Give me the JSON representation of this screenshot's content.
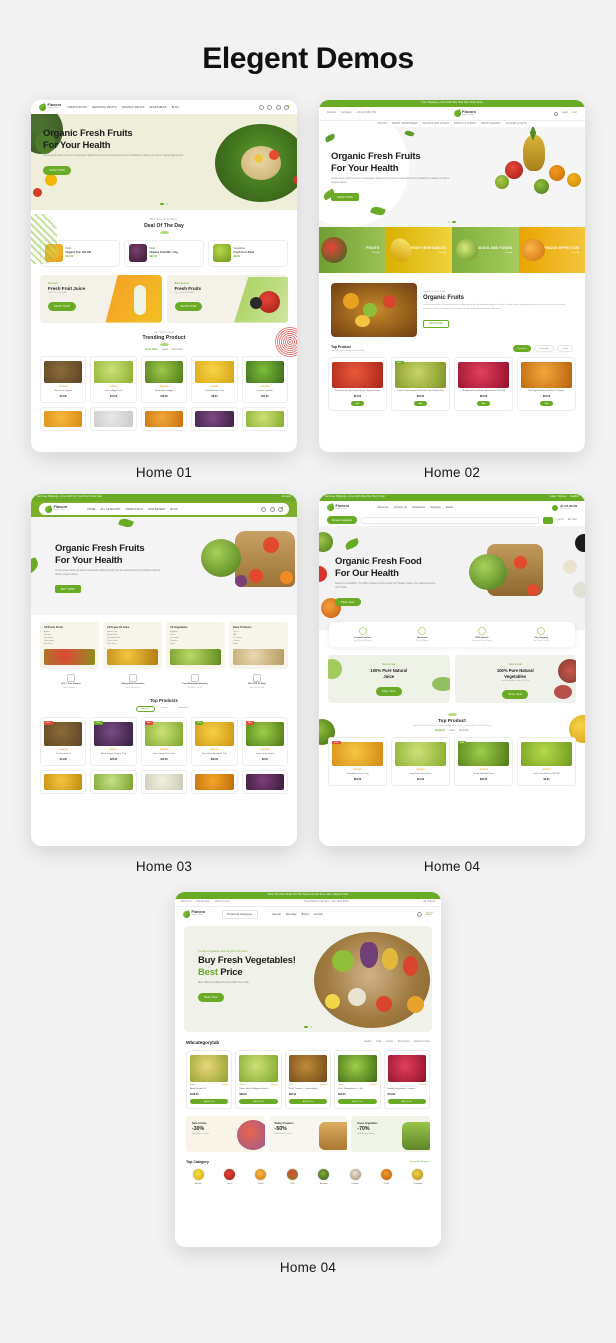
{
  "page": {
    "title": "Elegent Demos",
    "background": "#f2f2f2",
    "accent": "#6aab26"
  },
  "demos": [
    {
      "label": "Home 01",
      "brand": "Flavoro",
      "brand_tagline": "Organic Store",
      "announcement": "",
      "nav": [
        "FRESH FRUITS",
        "SEASONAL FRUITS",
        "ORGANIC FRUITS",
        "VEGETABLES",
        "BLOG"
      ],
      "hero": {
        "heading_line1": "Organic Fresh Fruits",
        "heading_line2": "For Your Health",
        "paragraph": "Lorem ipsum dolor sit amet consectetur adipiscing elit sed do eiusmod tempor incididunt ut labore et dolore magna aliqua enim.",
        "button": "SHOP NOW"
      },
      "deal": {
        "sub": "Best Special Products",
        "heading": "Deal Of The Day"
      },
      "deal_items": [
        {
          "tag": "30%",
          "cat": "Fruits",
          "name": "Organic Tea, 100 GM",
          "price": "$12.00",
          "old": "$18.00"
        },
        {
          "tag": "20%",
          "cat": "Fruits",
          "name": "Organic Fruit Mix, 1 Kg",
          "price": "$22.00",
          "old": "$30.00"
        },
        {
          "tag": "15%",
          "cat": "Vegetables",
          "name": "Fresh Corn Pack",
          "price": "$9.00",
          "old": "$14.00"
        }
      ],
      "promos": [
        {
          "sub": "Summer",
          "heading": "Fresh Fruit Juice",
          "paragraph": "Up to 30% Off Today",
          "button": "SHOP NOW"
        },
        {
          "sub": "Best Season",
          "heading": "Fresh Fruits",
          "paragraph": "Up to 40% Off Today",
          "button": "SHOP NOW"
        }
      ],
      "trending": {
        "sub": "Our Top Product",
        "heading": "Trending Product"
      },
      "trending_tabs": [
        "Fresh Juice",
        "Latest",
        "Best Seller"
      ],
      "products": [
        {
          "name": "Kiwi Fresh Organic",
          "price": "$14.00",
          "old": "$20.00",
          "stars": "★★★★★",
          "tag": "NEW"
        },
        {
          "name": "Green Apple Pack",
          "price": "$11.00",
          "old": "$16.00",
          "stars": "★★★★☆",
          "tag": ""
        },
        {
          "name": "Fresh Green Veggie",
          "price": "$18.00",
          "old": "$24.00",
          "stars": "★★★★★",
          "tag": "SALE"
        },
        {
          "name": "Yellow Banana 1 Kg",
          "price": "$8.00",
          "old": "$12.00",
          "stars": "★★★★☆",
          "tag": ""
        },
        {
          "name": "Organic Leaf Mix",
          "price": "$21.00",
          "old": "$28.00",
          "stars": "★★★★★",
          "tag": ""
        }
      ]
    },
    {
      "label": "Home 02",
      "brand": "Flavoro",
      "brand_tagline": "Organic Store",
      "announcement": "Free Shipping + Free Gifts Buy Now Next Order Now",
      "topbar_left": [
        "Contact",
        "Compare",
        "+91 123 456 789"
      ],
      "topbar_right": [
        "Search",
        "Login",
        "Cart"
      ],
      "nav": [
        "FRUITS",
        "FRESH VEGETABLES",
        "SNACKS AND FOODS",
        "DRINKS & JUICES",
        "FRESH BAKERY",
        "ALMOND & NUTS"
      ],
      "hero": {
        "heading_line1": "Organic Fresh Fruits",
        "heading_line2": "For Your Health",
        "paragraph": "Lorem ipsum dolor sit amet consectetur adipiscing elit sed do eiusmod tempor incididunt ut labore et dolore magna aliqua.",
        "button": "SHOP NOW"
      },
      "categories": [
        {
          "name": "FRUITS",
          "sub": "Shop All",
          "color": "#8bbc45"
        },
        {
          "name": "FRESH VEGETABLES",
          "sub": "Shop All",
          "color": "#e2b400"
        },
        {
          "name": "SNACKS AND FOODS",
          "sub": "Shop All",
          "color": "#8bbc45"
        },
        {
          "name": "ENORMOUS EFFECTUM",
          "sub": "Shop All",
          "color": "#e9a800"
        }
      ],
      "about": {
        "sub": "Organic / Fresh / Fruits",
        "heading": "Organic Fruits",
        "paragraph": "Lorem ipsum dolor sit amet consectetur adipiscing elit sed do eiusmod tempor incididunt ut labore dolore magna aliqua enim ad minim veniam quis nostrud exercitation ullamco laboris nisi ut aliquip ex ea commodo consequat duis aute irure.",
        "button": "READ MORE"
      },
      "top_product": {
        "heading": "Top Product",
        "sub": "Our Top Product Of Amazing Low Buy"
      },
      "top_tabs": [
        "Featured",
        "Bestseller",
        "Latest"
      ],
      "products": [
        {
          "name": "Fresh Hot Quality Tomato Sauce, 1kg Bulk Pack",
          "price": "$14.00",
          "old": "$20.00",
          "stars": "★★★★☆",
          "tag": ""
        },
        {
          "name": "Organic Dry Grapes, Perfect For Your Healthy Diet",
          "price": "$32.00",
          "old": "$40.00",
          "stars": "★★★★★",
          "tag": "SALE"
        },
        {
          "name": "Raspberry Fresh Nature Berry Basket 250 GM",
          "price": "$18.00",
          "old": "$26.00",
          "stars": "★★★★☆",
          "tag": ""
        },
        {
          "name": "Mix Vegetable Assorted Set Of Organic",
          "price": "$25.00",
          "old": "$30.00",
          "stars": "★★★★★",
          "tag": ""
        }
      ]
    },
    {
      "label": "Home 03",
      "brand": "Flavoro",
      "brand_tagline": "Organic Store",
      "announcement": "Get Free Shipping + Free Gifts On Your Next Order Now",
      "nav": [
        "HOME",
        "ALL CATEGORY",
        "FRESH FRUIT",
        "OUR BAKERY",
        "BLOG"
      ],
      "hero": {
        "heading_line1": "Organic Fresh Fruits",
        "heading_line2": "For Your Health",
        "paragraph": "Lorem ipsum dolor sit amet consectetur adipiscing elit sed do eiusmod tempor incididunt labore dolore magna aliqua.",
        "button": "BUY NOW"
      },
      "category_cards": [
        {
          "title": "All Fresh Fruits",
          "items": [
            "Apples",
            "Oranges",
            "Strawberry",
            "Watermelon",
            "Kiwi Fruits"
          ]
        },
        {
          "title": "All Types Of Juice",
          "items": [
            "Lemon Juice",
            "Mango Juice",
            "Vegetable Juice",
            "Cherry Juice",
            "Plum Juice"
          ]
        },
        {
          "title": "All Vegetables",
          "items": [
            "Eggplant",
            "Carrot",
            "Cucumber",
            "Pumpkin",
            "Onion"
          ]
        },
        {
          "title": "Dairy Products",
          "items": [
            "Yogurt",
            "Milk",
            "Ice Cream",
            "Cheese",
            "Butter"
          ]
        }
      ],
      "services": [
        {
          "title": "24 X 7 Free Support",
          "sub": "Online Support 24 / 7"
        },
        {
          "title": "Money Back Guarantee",
          "sub": "100% Money Back"
        },
        {
          "title": "Free Worldwide Shipping",
          "sub": "On Order Over $99"
        },
        {
          "title": "Win $100 To Shop",
          "sub": "Buy Now Win Gift"
        }
      ],
      "top_products": {
        "heading": "Top Products"
      },
      "top_tabs": [
        "Featured",
        "Latest",
        "Bestseller"
      ],
      "products": [
        {
          "name": "Kiwi Fresh Fruit",
          "price": "$14.00",
          "old": "$20.00",
          "stars": "★★★★★",
          "tag": "SALE"
        },
        {
          "name": "Black Grapes Organic 1 Kg",
          "price": "$26.00",
          "old": "$35.00",
          "stars": "★★★★☆",
          "tag": "NEW"
        },
        {
          "name": "Fresh Green Pear Pack",
          "price": "$12.00",
          "old": "$18.00",
          "stars": "★★★★★",
          "tag": "SALE"
        },
        {
          "name": "Pure Yellow Mangoes 2 Kg",
          "price": "$30.00",
          "old": "$42.00",
          "stars": "★★★★☆",
          "tag": "NEW"
        },
        {
          "name": "Long Green Gourd",
          "price": "$9.00",
          "old": "$14.00",
          "stars": "★★★★★",
          "tag": "SALE"
        }
      ]
    },
    {
      "label": "Home 04",
      "brand": "Flavoro",
      "brand_tagline": "Organic Store",
      "announcement": "Get Free Shipping + Free Gifts Now Buy Next Order",
      "topbar_right": [
        "Login / Signup",
        "English"
      ],
      "nav": [
        "About Us",
        "Contact Us",
        "Collections",
        "Shipping",
        "Deals"
      ],
      "phone": {
        "number": "+91 123 456 789",
        "label": "24/7 Support"
      },
      "search_placeholder": "Search Product...",
      "browse_button": "Browse Categories",
      "account": [
        "Log In",
        "My Cart"
      ],
      "hero": {
        "heading_line1": "Organic Fresh Food",
        "heading_line2": "For Our Health",
        "paragraph": "Reach For Healthier You With Organic Fresh Foods Our Health Foods Your Natural Choice Your Taste.",
        "button": "Shop Now"
      },
      "features": [
        {
          "title": "Curated Products",
          "sub": "Find The Best Product"
        },
        {
          "title": "Handmade",
          "sub": "Order Of Nature"
        },
        {
          "title": "100% Natural",
          "sub": "Get Fresh Natural Foods"
        },
        {
          "title": "Free Shipping",
          "sub": "Free Order Over $99"
        }
      ],
      "promos": [
        {
          "sub": "New arrival",
          "heading_line1": "100% Pure Natural",
          "heading_line2": "Juice",
          "paragraph": "",
          "button": "Shop Now"
        },
        {
          "sub": "New arrival",
          "heading_line1": "100% Pure Natural",
          "heading_line2": "Vegetables",
          "paragraph": "Fresh Vegetable Sale 30% Off",
          "button": "Shop Now"
        }
      ],
      "top_product": {
        "heading": "Top Product",
        "sub": "Organic Food In Fresh Products Mix With Your Compo With The Nutrients"
      },
      "top_tabs": [
        "Featured",
        "Latest",
        "Bestseller"
      ],
      "products": [
        {
          "name": "Fresh Apricot Fruit 1 Kg",
          "price": "$18.00",
          "old": "$25.00",
          "stars": "★★★★★",
          "tag": "SALE"
        },
        {
          "name": "Long Green Gourd Pack",
          "price": "$11.00",
          "old": "$16.00",
          "stars": "★★★★☆",
          "tag": ""
        },
        {
          "name": "Mixed Vegetable Tray",
          "price": "$26.00",
          "old": "$34.00",
          "stars": "★★★★★",
          "tag": "NEW"
        },
        {
          "name": "Fresh Green Beans 500 GM",
          "price": "$9.00",
          "old": "$13.00",
          "stars": "★★★★☆",
          "tag": ""
        }
      ]
    },
    {
      "label": "Home 04",
      "brand": "Flavoro",
      "brand_tagline": "Organic Store",
      "announcement": "Shop The Most Deals Off The Week And Get Free Gifts / Explore Now",
      "topbar_left": [
        "About Us",
        "My Account",
        "Wish List (0)"
      ],
      "topbar_center": "Need Help? Call Now : +91 1234 5678",
      "topbar_right": "All Orders",
      "browse_button": "Browse All Categories",
      "nav": [
        "Special",
        "Site Map",
        "Brand",
        "Contact"
      ],
      "cart": {
        "label": "My Cart",
        "total": "$0.00"
      },
      "hero": {
        "sub": "The Best Vegetables Store By All In One Store",
        "heading_line1": "Buy Fresh Vegetables!",
        "heading_accent": "Best",
        "heading_rest": " Price",
        "paragraph": "Best Offers And Big Discounts With Free Gifts",
        "button": "Shop Now"
      },
      "category_tab": {
        "heading": "Wbcategorytab"
      },
      "category_tabs": [
        "Exotic",
        "Kiwi",
        "Fruits",
        "Dry Fruits",
        "Exotics Fruits"
      ],
      "products": [
        {
          "tag": "Exotic",
          "name": "Apple Flavour 94°",
          "price": "$118.00",
          "old": "$135.00",
          "stars": "★★★★★",
          "count": "(3)",
          "button": "Add To Cart"
        },
        {
          "tag": "Classic",
          "name": "Rustic Early Fall Apples Bosco...",
          "price": "$98.00",
          "old": "$115.00",
          "stars": "★★★★★",
          "count": "(8)",
          "button": "Add To Cart"
        },
        {
          "tag": "ECO",
          "name": "Fresh Turmeric - Organically A...",
          "price": "$26.00",
          "old": "$31.00",
          "stars": "★★★★★",
          "count": "(5)",
          "button": "Add To Cart"
        },
        {
          "tag": "Exotic",
          "name": "Fruit - Mangosteen's, 1 Kg",
          "price": "$20.00",
          "old": "$28.00",
          "stars": "★★★★★",
          "count": "(8)",
          "button": "Add To Cart"
        },
        {
          "tag": "",
          "name": "Healthy Vegetables - Organic...",
          "price": "$74.99",
          "old": "$90.00",
          "stars": "★★★★★",
          "count": "(4)",
          "button": "Add To Cart"
        }
      ],
      "banners": [
        {
          "title": "New Arrivals",
          "discount": "-30%",
          "sub": "Made By Best Process"
        },
        {
          "title": "Bakery Products",
          "discount": "-50%",
          "sub": "Made By Best Process"
        },
        {
          "title": "Green Vegetables",
          "discount": "-70%",
          "sub": "Made By Best Products"
        }
      ],
      "top_category": {
        "heading": "Top Category",
        "link": "Browse All Categories"
      },
      "top_category_items": [
        {
          "name": "Banana"
        },
        {
          "name": "Cherry"
        },
        {
          "name": "Peach"
        },
        {
          "name": "Chilli"
        },
        {
          "name": "Avocado"
        },
        {
          "name": "Coconut"
        },
        {
          "name": "Carrot"
        },
        {
          "name": "Pineapple"
        }
      ]
    }
  ]
}
